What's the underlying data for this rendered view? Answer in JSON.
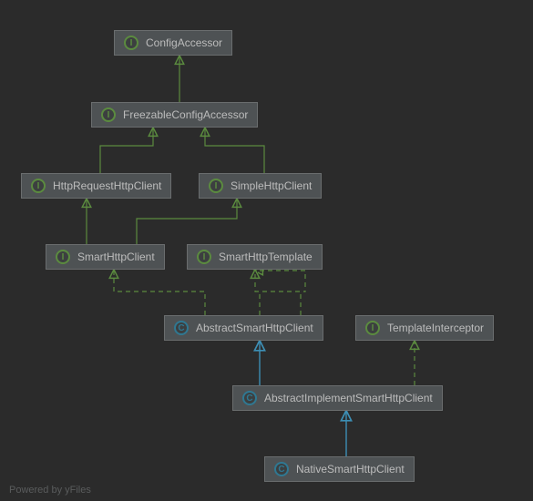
{
  "nodes": {
    "configAccessor": {
      "label": "ConfigAccessor",
      "type": "I"
    },
    "freezableConfigAccessor": {
      "label": "FreezableConfigAccessor",
      "type": "I"
    },
    "httpRequestHttpClient": {
      "label": "HttpRequestHttpClient",
      "type": "I"
    },
    "simpleHttpClient": {
      "label": "SimpleHttpClient",
      "type": "I"
    },
    "smartHttpClient": {
      "label": "SmartHttpClient",
      "type": "I"
    },
    "smartHttpTemplate": {
      "label": "SmartHttpTemplate",
      "type": "I"
    },
    "abstractSmartHttpClient": {
      "label": "AbstractSmartHttpClient",
      "type": "C"
    },
    "templateInterceptor": {
      "label": "TemplateInterceptor",
      "type": "I"
    },
    "abstractImplementSmartHttpClient": {
      "label": "AbstractImplementSmartHttpClient",
      "type": "C"
    },
    "nativeSmartHttpClient": {
      "label": "NativeSmartHttpClient",
      "type": "C"
    }
  },
  "footer": "Powered by yFiles",
  "chart_data": {
    "type": "class-hierarchy",
    "nodes": [
      {
        "id": "ConfigAccessor",
        "kind": "interface"
      },
      {
        "id": "FreezableConfigAccessor",
        "kind": "interface"
      },
      {
        "id": "HttpRequestHttpClient",
        "kind": "interface"
      },
      {
        "id": "SimpleHttpClient",
        "kind": "interface"
      },
      {
        "id": "SmartHttpClient",
        "kind": "interface"
      },
      {
        "id": "SmartHttpTemplate",
        "kind": "interface"
      },
      {
        "id": "AbstractSmartHttpClient",
        "kind": "class"
      },
      {
        "id": "TemplateInterceptor",
        "kind": "interface"
      },
      {
        "id": "AbstractImplementSmartHttpClient",
        "kind": "class"
      },
      {
        "id": "NativeSmartHttpClient",
        "kind": "class"
      }
    ],
    "edges": [
      {
        "from": "FreezableConfigAccessor",
        "to": "ConfigAccessor",
        "rel": "extends-interface"
      },
      {
        "from": "HttpRequestHttpClient",
        "to": "FreezableConfigAccessor",
        "rel": "extends-interface"
      },
      {
        "from": "SimpleHttpClient",
        "to": "FreezableConfigAccessor",
        "rel": "extends-interface"
      },
      {
        "from": "SmartHttpClient",
        "to": "HttpRequestHttpClient",
        "rel": "extends-interface"
      },
      {
        "from": "SmartHttpClient",
        "to": "SimpleHttpClient",
        "rel": "extends-interface"
      },
      {
        "from": "AbstractSmartHttpClient",
        "to": "SmartHttpClient",
        "rel": "implements"
      },
      {
        "from": "AbstractSmartHttpClient",
        "to": "SmartHttpTemplate",
        "rel": "implements"
      },
      {
        "from": "AbstractImplementSmartHttpClient",
        "to": "AbstractSmartHttpClient",
        "rel": "extends-class"
      },
      {
        "from": "AbstractImplementSmartHttpClient",
        "to": "TemplateInterceptor",
        "rel": "implements"
      },
      {
        "from": "NativeSmartHttpClient",
        "to": "AbstractImplementSmartHttpClient",
        "rel": "extends-class"
      }
    ]
  }
}
